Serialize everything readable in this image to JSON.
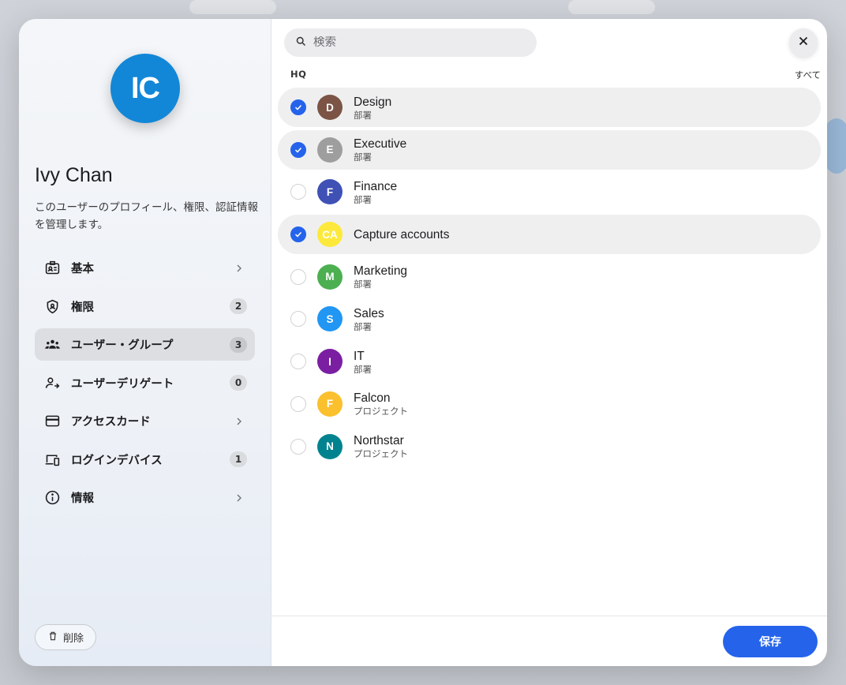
{
  "profile": {
    "initials": "IC",
    "avatar_color": "#1287d8",
    "name": "Ivy Chan",
    "description": "このユーザーのプロフィール、権限、認証情報を管理します。"
  },
  "nav": [
    {
      "label": "基本",
      "icon": "id-badge-icon",
      "count": null,
      "chevron": true,
      "active": false
    },
    {
      "label": "権限",
      "icon": "shield-icon",
      "count": "2",
      "chevron": false,
      "active": false
    },
    {
      "label": "ユーザー・グループ",
      "icon": "group-icon",
      "count": "3",
      "chevron": false,
      "active": true
    },
    {
      "label": "ユーザーデリゲート",
      "icon": "user-delegate-icon",
      "count": "0",
      "chevron": false,
      "active": false
    },
    {
      "label": "アクセスカード",
      "icon": "credit-card-icon",
      "count": null,
      "chevron": true,
      "active": false
    },
    {
      "label": "ログインデバイス",
      "icon": "devices-icon",
      "count": "1",
      "chevron": false,
      "active": false
    },
    {
      "label": "情報",
      "icon": "info-icon",
      "count": null,
      "chevron": true,
      "active": false
    }
  ],
  "delete_label": "削除",
  "search": {
    "placeholder": "検索"
  },
  "section": {
    "label": "HQ",
    "select_all": "すべて"
  },
  "groups": [
    {
      "initials": "D",
      "name": "Design",
      "type": "部署",
      "color": "#7b5446",
      "selected": true
    },
    {
      "initials": "E",
      "name": "Executive",
      "type": "部署",
      "color": "#9e9e9e",
      "selected": true
    },
    {
      "initials": "F",
      "name": "Finance",
      "type": "部署",
      "color": "#3f51b5",
      "selected": false
    },
    {
      "initials": "CA",
      "name": "Capture accounts",
      "type": "",
      "color": "#fde93b",
      "selected": true
    },
    {
      "initials": "M",
      "name": "Marketing",
      "type": "部署",
      "color": "#4caf50",
      "selected": false
    },
    {
      "initials": "S",
      "name": "Sales",
      "type": "部署",
      "color": "#2196f3",
      "selected": false
    },
    {
      "initials": "I",
      "name": "IT",
      "type": "部署",
      "color": "#7b1fa2",
      "selected": false
    },
    {
      "initials": "F",
      "name": "Falcon",
      "type": "プロジェクト",
      "color": "#fbc02d",
      "selected": false
    },
    {
      "initials": "N",
      "name": "Northstar",
      "type": "プロジェクト",
      "color": "#00838f",
      "selected": false
    }
  ],
  "save_label": "保存",
  "accent_color": "#2563eb"
}
